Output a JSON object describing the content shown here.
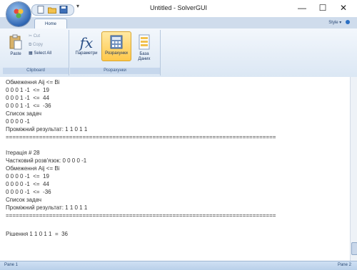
{
  "window": {
    "title": "Untitled - SolverGUI",
    "minimize": "—",
    "maximize": "☐",
    "close": "✕"
  },
  "ribbon": {
    "tabs": [
      "Home"
    ],
    "style_label": "Style",
    "clipboard": {
      "paste": "Paste",
      "cut": "Cut",
      "copy": "Copy",
      "select_all": "Select All",
      "group_label": "Clipboard"
    },
    "solutions": {
      "params": "Параметри",
      "solutions": "Розрахунки",
      "database_line1": "База",
      "database_line2": "Даних",
      "group_label": "Розрахунки"
    }
  },
  "content": {
    "lines": [
      "Обмеження Aij <= Bi",
      "0 0 0 1 -1  <=  19",
      "0 0 0 1 -1  <=  44",
      "0 0 0 1 -1  <=  -36",
      "Список задач",
      "0 0 0 0 -1",
      "Проміжний результат: 1 1 0 1 1",
      "=================================================================================",
      "",
      "Ітерація # 28",
      "Частковий розв'язок: 0 0 0 0 -1",
      "Обмеження Aij <= Bi",
      "0 0 0 0 -1  <=  19",
      "0 0 0 0 -1  <=  44",
      "0 0 0 0 -1  <=  -36",
      "Список задач",
      "Проміжний результат: 1 1 0 1 1",
      "=================================================================================",
      "",
      "Рішення 1 1 0 1 1  =  36"
    ]
  },
  "status": {
    "pane1": "Pane 1",
    "pane2": "Pane 2"
  }
}
